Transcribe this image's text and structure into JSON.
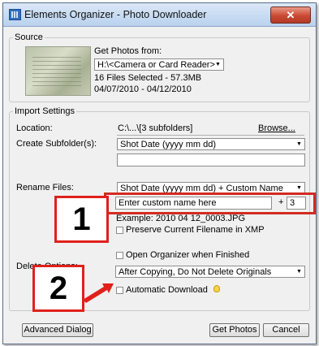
{
  "window": {
    "title": "Elements Organizer - Photo Downloader",
    "close_label": "✕"
  },
  "source": {
    "legend": "Source",
    "get_photos_label": "Get Photos from:",
    "device_value": "H:\\<Camera or Card Reader>",
    "files_selected": "16 Files Selected - 57.3MB",
    "date_range": "04/07/2010 - 04/12/2010"
  },
  "import": {
    "legend": "Import Settings",
    "location_label": "Location:",
    "location_value": "C:\\...\\[3 subfolders]",
    "browse_label": "Browse...",
    "subfolder_label": "Create Subfolder(s):",
    "subfolder_value": "Shot Date (yyyy mm dd)",
    "subfolder_custom_value": "",
    "rename_label": "Rename Files:",
    "rename_value": "Shot Date (yyyy mm dd) + Custom Name",
    "custom_name_placeholder": "Enter custom name here",
    "plus_sign": "+",
    "start_number": "3",
    "example_text": "Example: 2010 04 12_0003.JPG",
    "preserve_label": "Preserve Current Filename in XMP",
    "open_organizer_label": "Open Organizer when Finished",
    "delete_label": "Delete Options:",
    "delete_value": "After Copying, Do Not Delete Originals",
    "auto_download_label": "Automatic Download"
  },
  "footer": {
    "advanced_label": "Advanced Dialog",
    "get_photos_button": "Get Photos",
    "cancel_label": "Cancel"
  },
  "callouts": {
    "one": "1",
    "two": "2"
  },
  "colors": {
    "callout_red": "#e0201c"
  }
}
